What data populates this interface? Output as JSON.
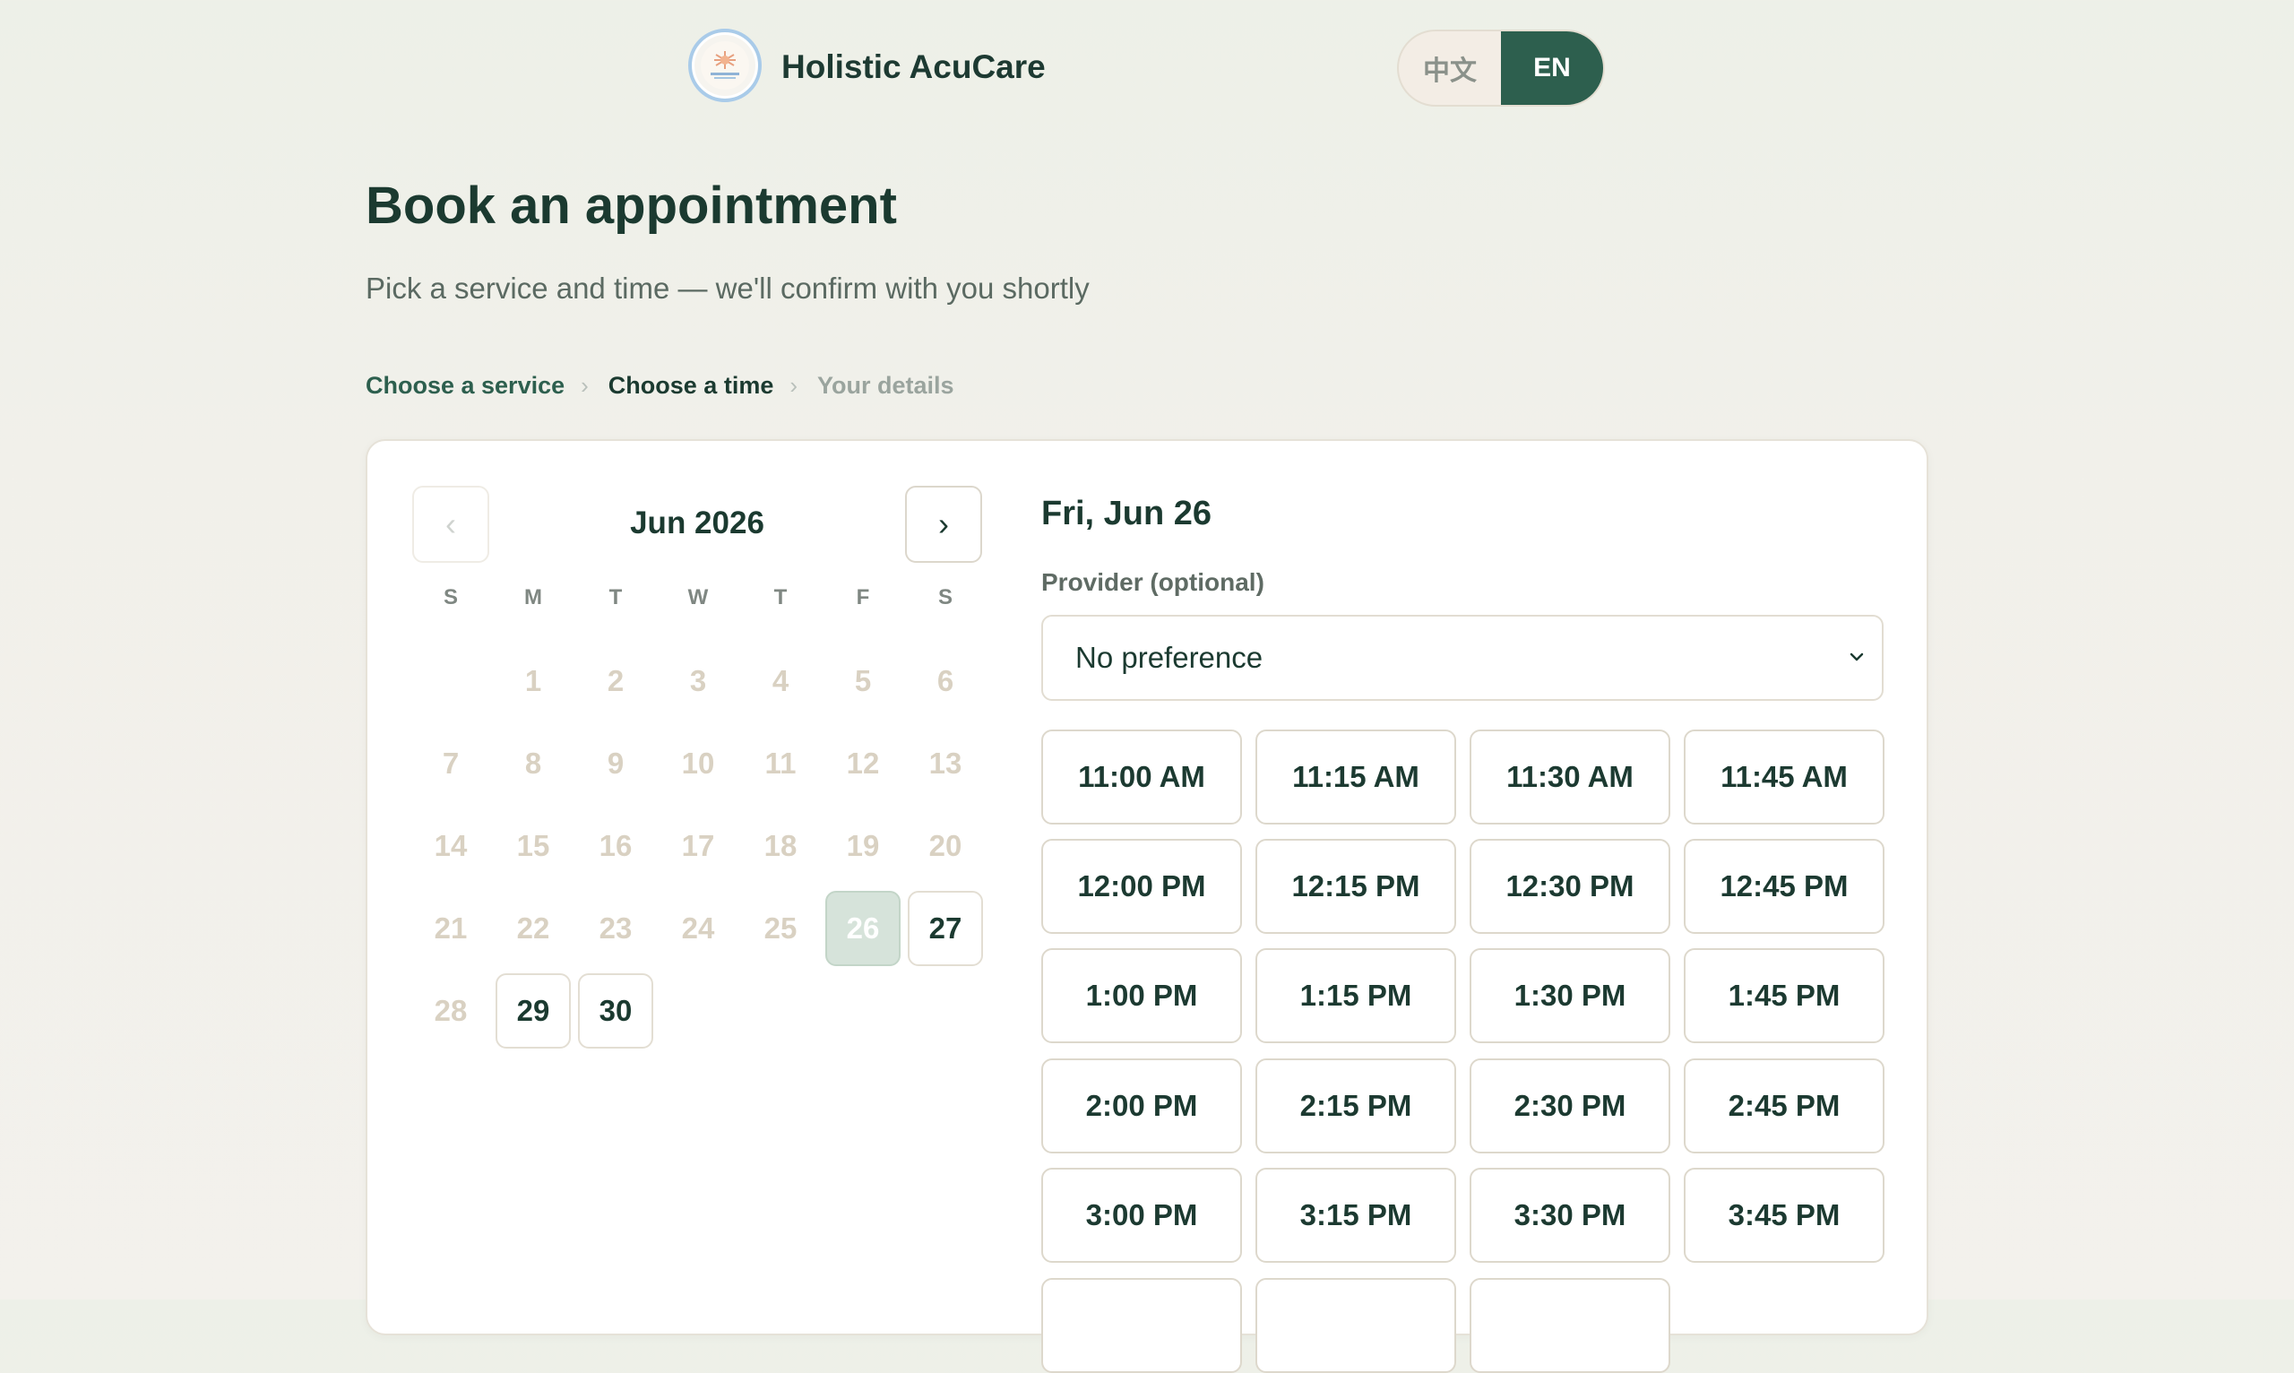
{
  "brand": {
    "name": "Holistic AcuCare"
  },
  "language": {
    "options": [
      "中文",
      "EN"
    ],
    "active": "EN"
  },
  "page": {
    "title": "Book an appointment",
    "subtitle": "Pick a service and time — we'll confirm with you shortly"
  },
  "steps": {
    "items": [
      "Choose a service",
      "Choose a time",
      "Your details"
    ],
    "separator": "›"
  },
  "calendar": {
    "month_label": "Jun 2026",
    "prev_icon": "‹",
    "next_icon": "›",
    "weekdays": [
      "S",
      "M",
      "T",
      "W",
      "T",
      "F",
      "S"
    ],
    "days": {
      "d1": "1",
      "d2": "2",
      "d3": "3",
      "d4": "4",
      "d5": "5",
      "d6": "6",
      "d7": "7",
      "d8": "8",
      "d9": "9",
      "d10": "10",
      "d11": "11",
      "d12": "12",
      "d13": "13",
      "d14": "14",
      "d15": "15",
      "d16": "16",
      "d17": "17",
      "d18": "18",
      "d19": "19",
      "d20": "20",
      "d21": "21",
      "d22": "22",
      "d23": "23",
      "d24": "24",
      "d25": "25",
      "d26": "26",
      "d27": "27",
      "d28": "28",
      "d29": "29",
      "d30": "30"
    },
    "selected_day": "26",
    "available_days": [
      "26",
      "27",
      "29",
      "30"
    ]
  },
  "schedule": {
    "selected_date": "Fri, Jun 26",
    "provider_label": "Provider (optional)",
    "provider_value": "No preference",
    "slots": [
      "11:00 AM",
      "11:15 AM",
      "11:30 AM",
      "11:45 AM",
      "12:00 PM",
      "12:15 PM",
      "12:30 PM",
      "12:45 PM",
      "1:00 PM",
      "1:15 PM",
      "1:30 PM",
      "1:45 PM",
      "2:00 PM",
      "2:15 PM",
      "2:30 PM",
      "2:45 PM",
      "3:00 PM",
      "3:15 PM",
      "3:30 PM",
      "3:45 PM"
    ]
  },
  "colors": {
    "primary": "#2d5f4e",
    "text_dark": "#1b3a30",
    "muted_day": "#d9d1c2",
    "selected_day_bg": "#d6e3da"
  }
}
